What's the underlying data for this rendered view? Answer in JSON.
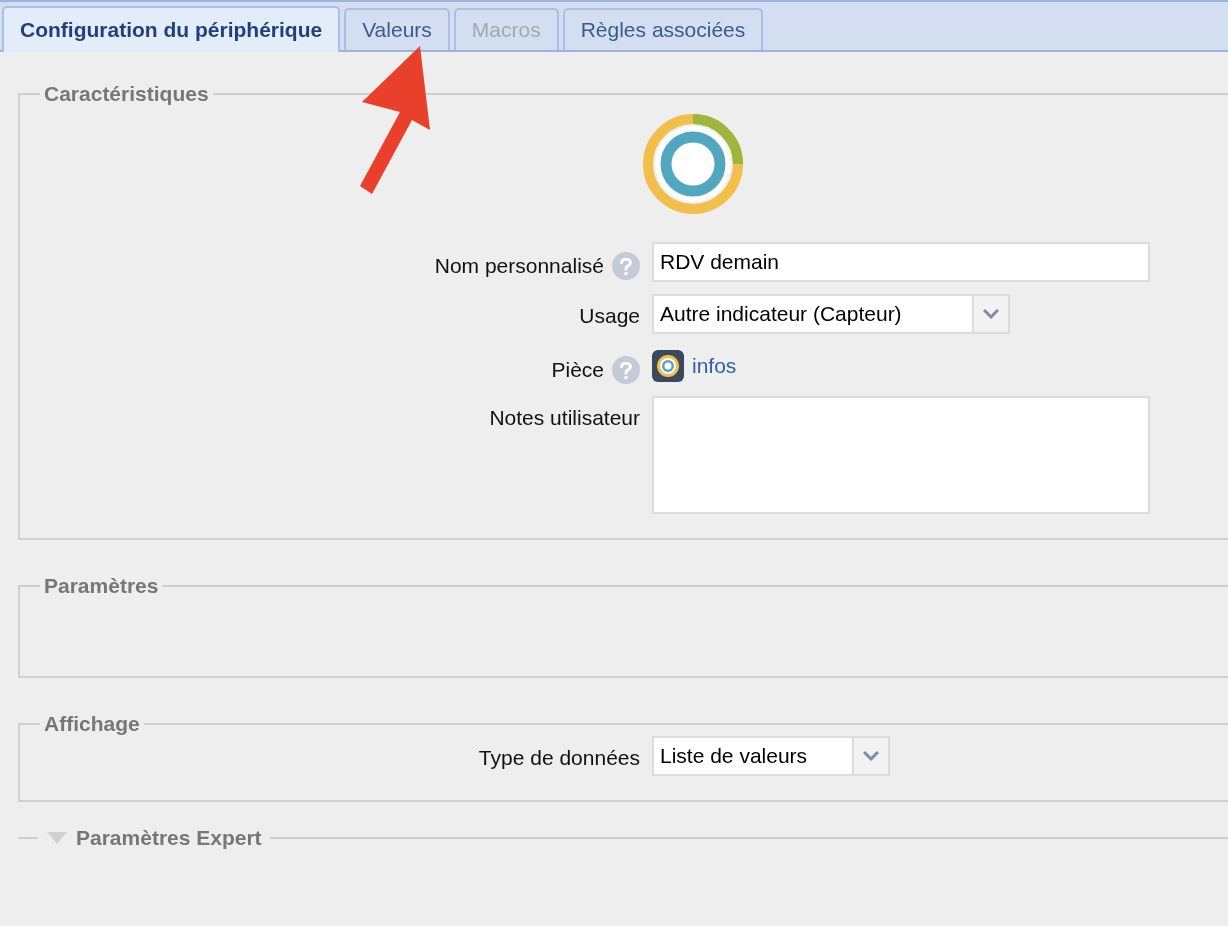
{
  "tabs": [
    {
      "label": "Configuration du périphérique",
      "selected": true,
      "disabled": false
    },
    {
      "label": "Valeurs",
      "selected": false,
      "disabled": false
    },
    {
      "label": "Macros",
      "selected": false,
      "disabled": true
    },
    {
      "label": "Règles associées",
      "selected": false,
      "disabled": false
    }
  ],
  "sections": [
    {
      "legend": "Caractéristiques",
      "kind": "form",
      "fields": [
        {
          "kind": "text",
          "label": "Nom personnalisé",
          "help": true,
          "value": "RDV demain"
        },
        {
          "kind": "select",
          "label": "Usage",
          "help": false,
          "value": "Autre indicateur (Capteur)"
        },
        {
          "kind": "link",
          "label": "Pièce",
          "help": true,
          "value": "infos"
        },
        {
          "kind": "textarea",
          "label": "Notes utilisateur",
          "help": false
        }
      ]
    },
    {
      "legend": "Paramètres",
      "kind": "empty"
    },
    {
      "legend": "Affichage",
      "kind": "form",
      "fields": [
        {
          "kind": "select",
          "label": "Type de données",
          "help": false,
          "value": "Liste de valeurs"
        }
      ]
    }
  ],
  "expert": {
    "legend": "Paramètres Expert",
    "expanded": false
  }
}
